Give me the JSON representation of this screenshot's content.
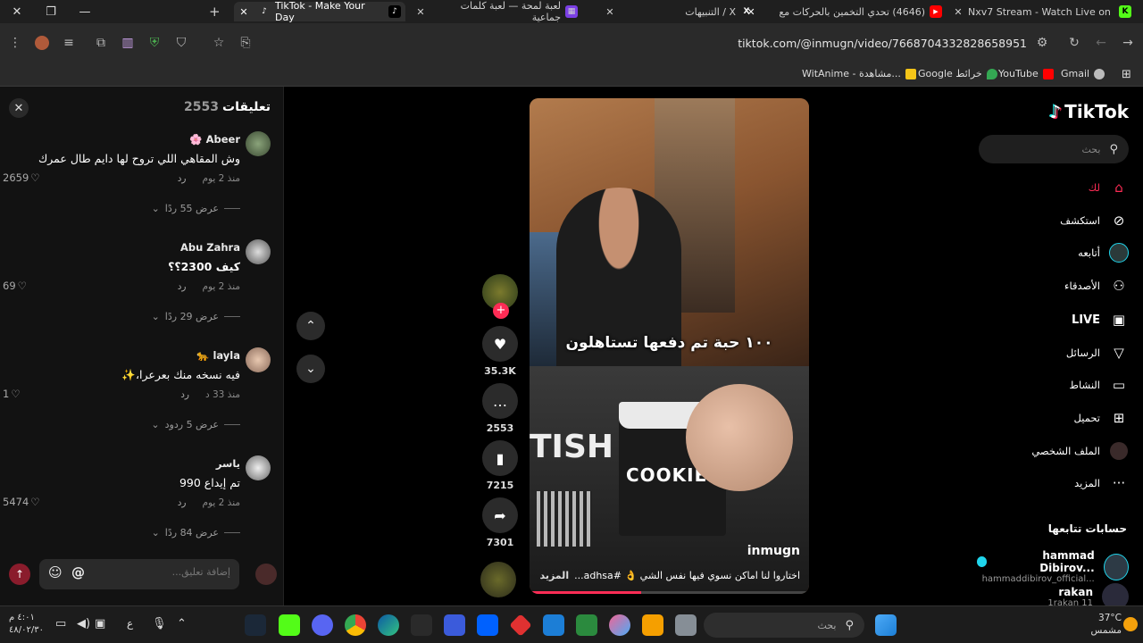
{
  "browser": {
    "tabs": [
      {
        "title": "Nxv7 Stream - Watch Live on K",
        "icon": "kick-icon",
        "color": "#53fc18"
      },
      {
        "title": "(4646) تحدي التخمين بالحركات مع",
        "icon": "youtube-icon",
        "color": "#ff0000"
      },
      {
        "title": "التنبيهات / X",
        "icon": "x-icon",
        "color": "#ffffff"
      },
      {
        "title": "لعبة لمحة — لعبة كلمات جماعية",
        "icon": "lamha-icon",
        "color": "#7b3fe4"
      },
      {
        "title": "TikTok - Make Your Day",
        "icon": "tiktok-icon",
        "color": "#ffffff"
      }
    ],
    "url": "tiktok.com/@inmugn/video/7668704332828658951",
    "bookmarks": [
      {
        "label": "Gmail",
        "icon": "google-icon"
      },
      {
        "label": "YouTube",
        "icon": "youtube-icon"
      },
      {
        "label": "خرائط Google",
        "icon": "maps-icon"
      },
      {
        "label": "WitAnime - مشاهدة...",
        "icon": "witanime-icon"
      }
    ]
  },
  "comments_panel": {
    "title": "تعليقات",
    "count": "2553",
    "comments": [
      {
        "name": "Abeer 🌸",
        "text": "وش المقاهي اللي تروح لها دايم طال عمرك",
        "time": "منذ 2 يوم",
        "reply": "رد",
        "likes": "2659",
        "view_replies": "عرض 55 ردًا"
      },
      {
        "name": "Abu Zahra",
        "text": "كيف 2300؟؟",
        "time": "منذ 2 يوم",
        "reply": "رد",
        "likes": "69",
        "view_replies": "عرض 29 ردًا"
      },
      {
        "name": "layla 🐆",
        "text": "فيه نسخه منك بعرعرا،✨",
        "time": "منذ 33 د",
        "reply": "رد",
        "likes": "1",
        "view_replies": "عرض 5 ردود"
      },
      {
        "name": "ياسر",
        "text": "تم إيداع 990",
        "time": "منذ 2 يوم",
        "reply": "رد",
        "likes": "5474",
        "view_replies": "عرض 84 ردًا"
      }
    ],
    "input_placeholder": "إضافة تعليق..."
  },
  "video": {
    "overlay_text": "١٠٠ حبة تم دفعها تستاهلون",
    "username": "inmugn",
    "caption": "اختاروا لنا اماكن نسوي فيها نفس الشي 👌 #adhsa...",
    "caption_more": "المزيد",
    "bag_label": "COOKIE",
    "sign_text": "TISH",
    "progress": 0.4,
    "actions": {
      "likes": "35.3K",
      "comments": "2553",
      "saves": "7215",
      "shares": "7301"
    }
  },
  "sidebar": {
    "logo": "TikTok",
    "search_placeholder": "بحث",
    "items": [
      {
        "label": "لك",
        "icon": "home-icon",
        "active": true
      },
      {
        "label": "استكشف",
        "icon": "compass-icon"
      },
      {
        "label": "أتابعه",
        "icon": "following-icon"
      },
      {
        "label": "الأصدقاء",
        "icon": "friends-icon"
      },
      {
        "label": "LIVE",
        "icon": "live-icon"
      },
      {
        "label": "الرسائل",
        "icon": "messages-icon"
      },
      {
        "label": "النشاط",
        "icon": "activity-icon"
      },
      {
        "label": "تحميل",
        "icon": "upload-icon"
      },
      {
        "label": "الملف الشخصي",
        "icon": "profile-icon"
      },
      {
        "label": "المزيد",
        "icon": "more-icon"
      }
    ],
    "following_title": "حسابات تتابعها",
    "following": [
      {
        "name": "hammad Dibirov...",
        "handle": "hammaddibirov_official...",
        "verified": true
      },
      {
        "name": "rakan",
        "handle": "1rakan 11",
        "verified": false
      }
    ]
  },
  "taskbar": {
    "search_placeholder": "بحث",
    "weather_temp": "37°C",
    "weather_desc": "مشمس",
    "time": "٤:٠١ م",
    "date": "٤٨/٠٢/٣٠",
    "lang": "ع"
  },
  "colors": {
    "accent": "#fe2c55",
    "background": "#000000",
    "panel": "#121212"
  }
}
